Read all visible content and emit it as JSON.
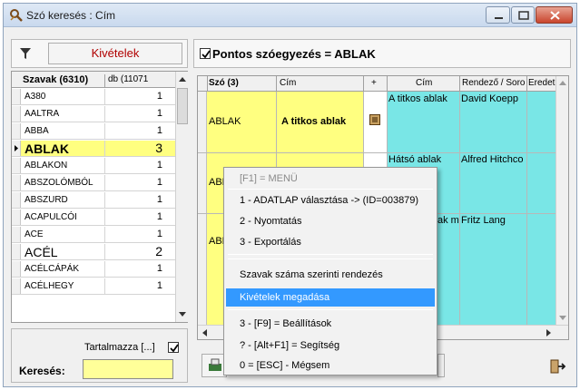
{
  "window": {
    "title": "Szó keresés : Cím"
  },
  "left": {
    "exceptions_button": "Kivételek",
    "header_words": "Szavak (6310)",
    "header_count": "db (11071",
    "rows": [
      {
        "word": "A380",
        "count": "1"
      },
      {
        "word": "AALTRA",
        "count": "1"
      },
      {
        "word": "ABBA",
        "count": "1"
      },
      {
        "word": "ABLAK",
        "count": "3"
      },
      {
        "word": "ABLAKON",
        "count": "1"
      },
      {
        "word": "ABSZOLÓMBÓL",
        "count": "1"
      },
      {
        "word": "ABSZURD",
        "count": "1"
      },
      {
        "word": "ACAPULCÓI",
        "count": "1"
      },
      {
        "word": "ACE",
        "count": "1"
      },
      {
        "word": "ACÉL",
        "count": "2"
      },
      {
        "word": "ACÉLCÁPÁK",
        "count": "1"
      },
      {
        "word": "ACÉLHEGY",
        "count": "1"
      }
    ],
    "contains_label": "Tartalmazza [...]",
    "search_label": "Keresés:",
    "search_value": ""
  },
  "right": {
    "exact_match": "Pontos szóegyezés = ABLAK",
    "headers": [
      "Szó (3)",
      "Cím",
      "+",
      "Cím",
      "Rendező / Sorо",
      "Eredet"
    ],
    "rows": [
      {
        "szo": "ABLAK",
        "cim": "A titkos ablak",
        "cim2": "A titkos ablak",
        "rendezo": "David Koepp"
      },
      {
        "szo": "ABLAK",
        "cim": "",
        "cim2": "Hátsó ablak",
        "rendezo": "Alfred Hitchco"
      },
      {
        "szo": "ABLAK",
        "cim": "",
        "cim2": "ak m",
        "rendezo": "Fritz Lang"
      }
    ]
  },
  "menu": {
    "items": [
      {
        "label": "[F1] = MENÜ",
        "disabled": true
      },
      {
        "label": "1 - ADATLAP választása -> (ID=003879)"
      },
      {
        "label": "2 - Nyomtatás"
      },
      {
        "label": "3 - Exportálás"
      },
      {
        "label": "Szavak száma szerinti rendezés"
      },
      {
        "label": "Kivételek megadása",
        "highlighted": true
      },
      {
        "label": "3 - [F9] = Beállítások"
      },
      {
        "label": "? - [Alt+F1] = Segítség"
      },
      {
        "label": "0 = [ESC] - Mégsem"
      }
    ]
  },
  "colors": {
    "yellow": "#ffff80",
    "cyan": "#79e6e6",
    "highlight": "#3399ff",
    "red_text": "#b00000"
  }
}
